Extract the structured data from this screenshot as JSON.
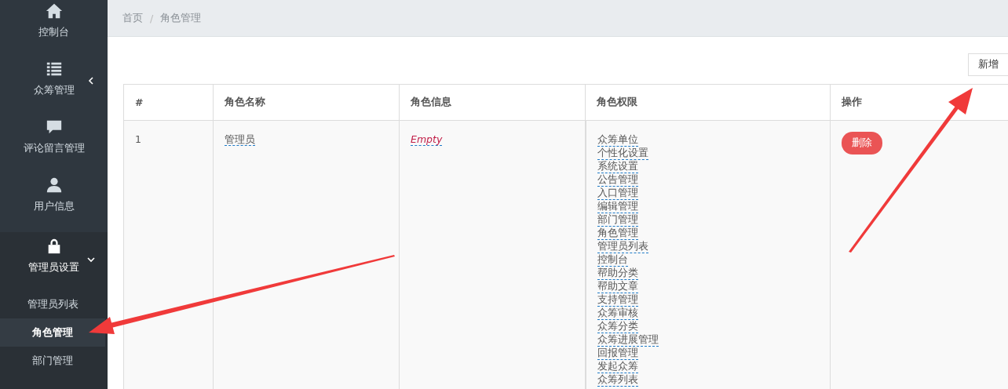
{
  "sidebar": {
    "items": [
      {
        "label": "控制台"
      },
      {
        "label": "众筹管理",
        "expanded": false
      },
      {
        "label": "评论留言管理"
      },
      {
        "label": "用户信息"
      },
      {
        "label": "管理员设置",
        "expanded": true,
        "children": [
          {
            "label": "管理员列表",
            "selected": false
          },
          {
            "label": "角色管理",
            "selected": true
          },
          {
            "label": "部门管理",
            "selected": false
          }
        ]
      }
    ]
  },
  "breadcrumb": [
    "首页",
    "角色管理"
  ],
  "breadcrumb_separator": "/",
  "add_button": "新增",
  "table": {
    "columns": [
      "#",
      "角色名称",
      "角色信息",
      "角色权限",
      "操作"
    ],
    "rows": [
      {
        "index": "1",
        "name": "管理员",
        "info": "Empty",
        "info_empty": true,
        "permissions": [
          "众筹单位",
          "个性化设置",
          "系统设置",
          "公告管理",
          "入口管理",
          "编辑管理",
          "部门管理",
          "角色管理",
          "管理员列表",
          "控制台",
          "帮助分类",
          "帮助文章",
          "支持管理",
          "众筹审核",
          "众筹分类",
          "众筹进展管理",
          "回报管理",
          "发起众筹",
          "众筹列表"
        ],
        "action": "删除"
      }
    ]
  }
}
